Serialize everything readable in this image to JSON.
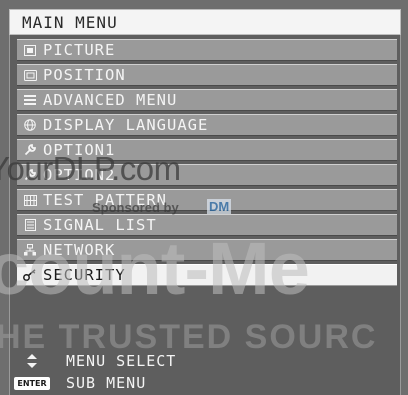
{
  "header": {
    "title": "MAIN MENU"
  },
  "menu": {
    "items": [
      {
        "label": "PICTURE",
        "icon": "picture-icon",
        "selected": false
      },
      {
        "label": "POSITION",
        "icon": "position-icon",
        "selected": false
      },
      {
        "label": "ADVANCED MENU",
        "icon": "advanced-menu-icon",
        "selected": false
      },
      {
        "label": "DISPLAY LANGUAGE",
        "icon": "globe-icon",
        "selected": false
      },
      {
        "label": "OPTION1",
        "icon": "wrench-icon",
        "selected": false
      },
      {
        "label": "OPTION2",
        "icon": "wrench-icon",
        "selected": false
      },
      {
        "label": "TEST PATTERN",
        "icon": "test-pattern-icon",
        "selected": false
      },
      {
        "label": "SIGNAL LIST",
        "icon": "signal-list-icon",
        "selected": false
      },
      {
        "label": "NETWORK",
        "icon": "network-icon",
        "selected": false
      },
      {
        "label": "SECURITY",
        "icon": "key-icon",
        "selected": true
      }
    ]
  },
  "footer": {
    "hints": [
      {
        "key": "up-down-arrows-icon",
        "label": "MENU SELECT"
      },
      {
        "key": "ENTER",
        "label": "SUB MENU"
      }
    ]
  },
  "watermarks": {
    "site": "YourDLP.com",
    "sponsor": "Sponsored by",
    "sponsor_logo": "DM",
    "brand": "count-Me",
    "slogan": "HE TRUSTED SOURC"
  },
  "colors": {
    "background": "#6e6e6e",
    "item": "#9a9a9a",
    "selected_item": "#f2f2f2",
    "title_bar": "#f4f4f4"
  }
}
